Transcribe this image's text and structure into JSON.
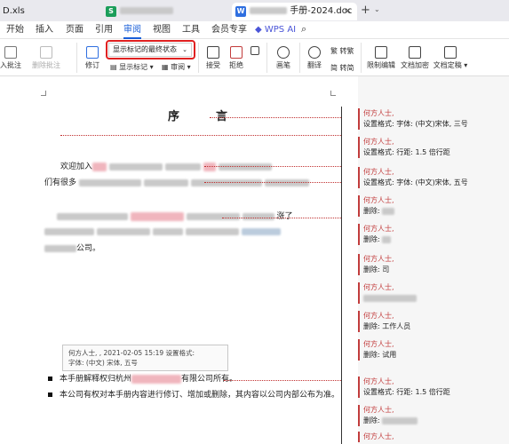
{
  "tabs": {
    "file1": "D.xls",
    "file2_icon": "S",
    "file3_icon": "W",
    "file3_name": "手册-2024.doc",
    "close": "×",
    "add": "+",
    "more": "⌄"
  },
  "menu": [
    "开始",
    "插入",
    "页面",
    "引用",
    "审阅",
    "视图",
    "工具",
    "会员专享",
    "WPS AI"
  ],
  "ribbon": {
    "insert_comment": "入批注",
    "delete_comment": "删除批注",
    "track_changes": "修订",
    "show_state": "显示标记的最终状态",
    "show_markup": "显示标记",
    "review": "审阅",
    "accept": "接受",
    "reject": "拒绝",
    "ink": "画笔",
    "translate": "翻译",
    "convert_simp": "转繁",
    "convert_trad": "转简",
    "restrict_edit": "限制编辑",
    "doc_encrypt": "文档加密",
    "doc_finalize": "文档定稿"
  },
  "doc": {
    "title": "序　言",
    "line1_start": "欢迎加入",
    "line2_start": "们有很多",
    "line3_end": "涨了",
    "line4_end": "公司。",
    "bullet1": "本手册解释权归杭州",
    "bullet1_end": "有限公司所有。",
    "bullet2": "本公司有权对本手册内容进行修订、增加或删除，其内容以公司内部公布为准。"
  },
  "tooltip": {
    "line1": "何方人士,  ,   2021-02-05 15:19 设置格式:",
    "line2": "字体: (中文) 宋体, 五号"
  },
  "comments": [
    {
      "author": "何方人士,",
      "body": "设置格式: 字体: (中文)宋体, 三号"
    },
    {
      "author": "何方人士,",
      "body": "设置格式: 行距: 1.5 倍行距"
    },
    {
      "author": "何方人士,",
      "body": "设置格式: 字体: (中文)宋体, 五号"
    },
    {
      "author": "何方人士,",
      "body": "删除:"
    },
    {
      "author": "何方人士,",
      "body": "删除:"
    },
    {
      "author": "何方人士,",
      "body": "删除: 司"
    },
    {
      "author": "何方人士,",
      "body": ""
    },
    {
      "author": "何方人士,",
      "body": "删除: 工作人员"
    },
    {
      "author": "何方人士,",
      "body": "删除: 试用"
    },
    {
      "author": "何方人士,",
      "body": "设置格式: 行距: 1.5 倍行距"
    },
    {
      "author": "何方人士,",
      "body": "删除:"
    },
    {
      "author": "何方人士,",
      "body": ""
    }
  ]
}
